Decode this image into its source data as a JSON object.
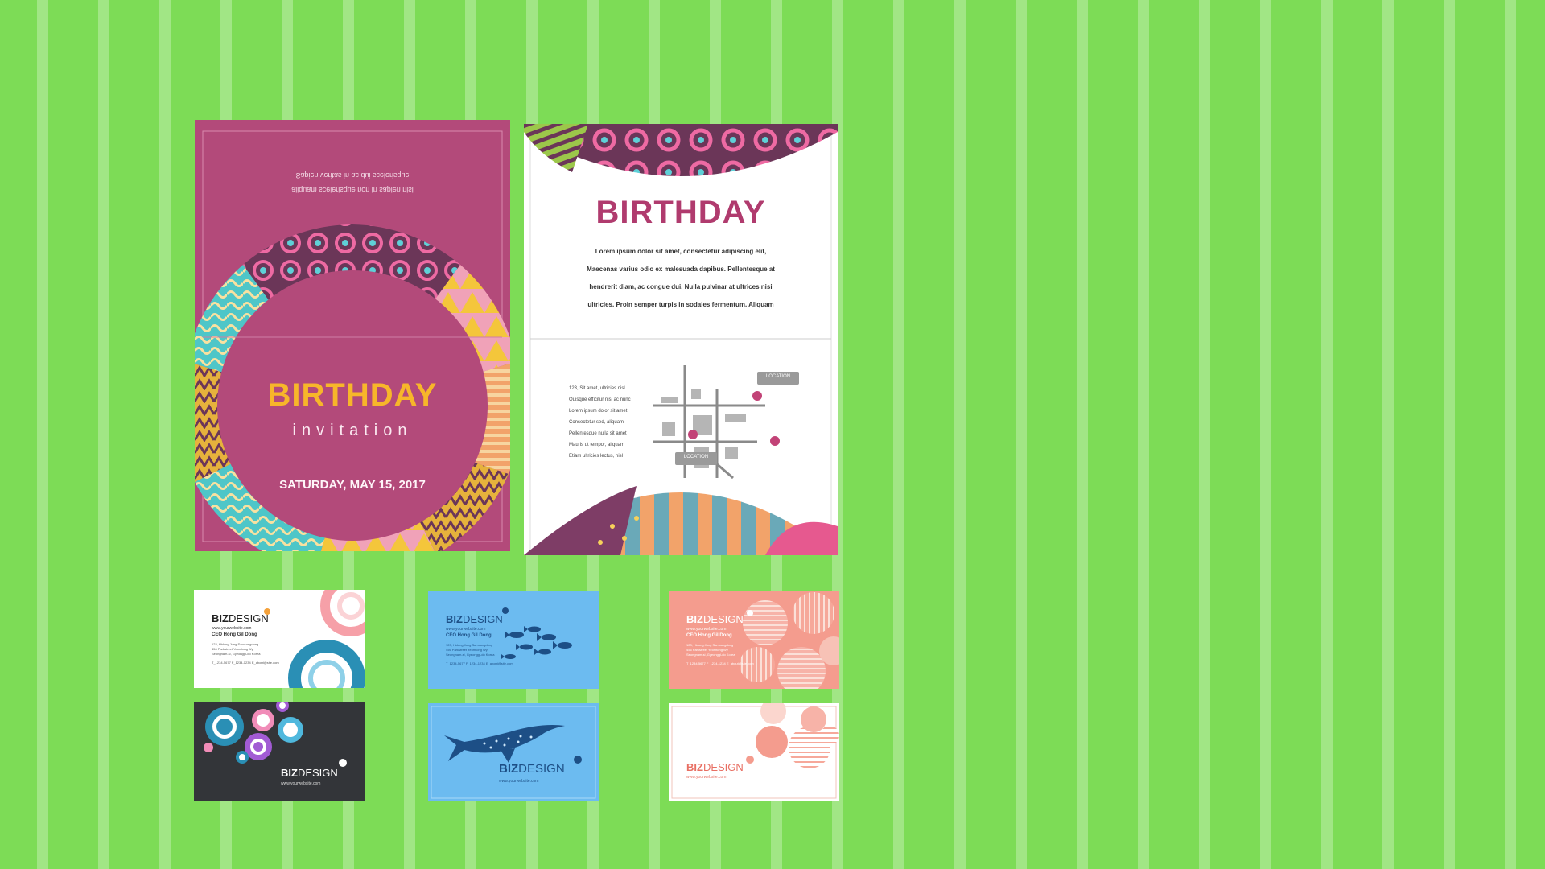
{
  "invitation": {
    "top_line_1": "Sapien veritas in ac dui scelerisque",
    "top_line_2": "aliquam scelerisque non in sapien nisl",
    "title": "BIRTHDAY",
    "subtitle": "invitation",
    "date": "SATURDAY, MAY 15, 2017"
  },
  "inner": {
    "title": "BIRTHDAY",
    "body_lines": [
      "Lorem ipsum dolor sit amet, consectetur adipiscing elit,",
      "Maecenas varius odio ex malesuada dapibus. Pellentesque at",
      "hendrerit diam, ac congue dui. Nulla pulvinar at ultrices nisi",
      "ultricies. Proin semper turpis in sodales fermentum. Aliquam"
    ],
    "address_lines": [
      "123, Sit amet, ultricies nisl",
      "Quisque efficitur nisi ac nunc",
      "Lorem ipsum dolor sit amet",
      "Consectetur sed, aliquam",
      "Pellentesque nulla sit amet",
      "Mauris ut tempor, aliquam",
      "Etiam ultricies lectus, nisl"
    ],
    "map_tag_1": "LOCATION",
    "map_tag_2": "LOCATION"
  },
  "cards": [
    {
      "brand_a": "BIZ",
      "brand_b": "DESIGN",
      "site": "www.yourwebsite.com",
      "name": "CEO  Hong Gil Dong",
      "lines": [
        "123, Hidong Jung Samsungdong",
        "456 Parkstreet Yeomtong Wy",
        "Seongnam-si, Gyeonggi-do Korea"
      ],
      "contact": "T_1234-5677   F_1234-1234   E_about@site.com"
    },
    {
      "brand_a": "BIZ",
      "brand_b": "DESIGN",
      "site": "www.yourwebsite.com"
    },
    {
      "brand_a": "BIZ",
      "brand_b": "DESIGN",
      "site": "www.yourwebsite.com",
      "name": "CEO  Hong Gil Dong",
      "lines": [
        "123, Hidong Jung Samsungdong",
        "456 Parkstreet Yeomtong Wy",
        "Seongnam-si, Gyeonggi-do Korea"
      ],
      "contact": "T_1234-5677   F_1234-1234   E_about@site.com"
    },
    {
      "brand_a": "BIZ",
      "brand_b": "DESIGN",
      "site": "www.yourwebsite.com"
    },
    {
      "brand_a": "BIZ",
      "brand_b": "DESIGN",
      "site": "www.yourwebsite.com",
      "name": "CEO  Hong Gil Dong",
      "lines": [
        "123, Hidong Jung Samsungdong",
        "456 Parkstreet Yeomtong Wy",
        "Seongnam-si, Gyeonggi-do Korea"
      ],
      "contact": "T_1234-5677   F_1234-1234   E_about@site.com"
    },
    {
      "brand_a": "BIZ",
      "brand_b": "DESIGN",
      "site": "www.yourwebsite.com"
    }
  ],
  "colors": {
    "background": "#7ddc56",
    "magenta": "#b34a7a",
    "plum": "#6b3658",
    "gold": "#f7b62a",
    "teal": "#2a8fb5",
    "sky": "#6cbbf0",
    "coral": "#f49c8e",
    "charcoal": "#333539"
  }
}
